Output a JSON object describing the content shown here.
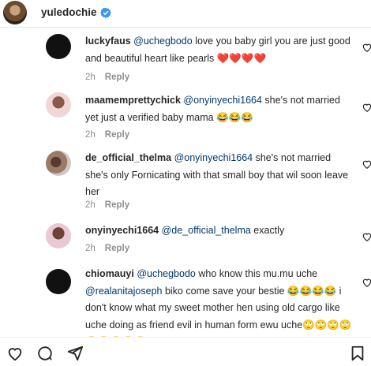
{
  "header": {
    "username": "yuledochie"
  },
  "comments": [
    {
      "user": "luckyfaus",
      "segments": [
        {
          "text": "@uchegbodo",
          "mention": true
        },
        {
          "text": " love you baby girl you are just good and beautiful heart like pearls ❤️❤️❤️❤️",
          "mention": false
        }
      ],
      "time": "2h",
      "reply": "Reply"
    },
    {
      "user": "maamemprettychick",
      "segments": [
        {
          "text": "@onyinyechi1664",
          "mention": true
        },
        {
          "text": " she's not married yet just a verified baby mama 😂😂😂",
          "mention": false
        }
      ],
      "time": "2h",
      "reply": "Reply"
    },
    {
      "user": "de_official_thelma",
      "segments": [
        {
          "text": "@onyinyechi1664",
          "mention": true
        },
        {
          "text": " she's not married she's only Fornicating with that small boy that wil soon leave her",
          "mention": false
        }
      ],
      "time": "2h",
      "reply": "Reply"
    },
    {
      "user": "onyinyechi1664",
      "segments": [
        {
          "text": "@de_official_thelma",
          "mention": true
        },
        {
          "text": " exactly",
          "mention": false
        }
      ],
      "time": "2h",
      "reply": "Reply"
    },
    {
      "user": "chiomauyi",
      "segments": [
        {
          "text": "@uchegbodo",
          "mention": true
        },
        {
          "text": " who know this mu.mu uche ",
          "mention": false
        },
        {
          "text": "@realanitajoseph",
          "mention": true
        },
        {
          "text": " biko come save your bestie 😂😂😂😂 i don't know what my sweet mother hen using old cargo like uche doing as friend evil in human form ewu uche🙄🙄🙄🙄🙄🙄🙄🙄🙄",
          "mention": false
        }
      ],
      "time": "",
      "reply": ""
    }
  ]
}
